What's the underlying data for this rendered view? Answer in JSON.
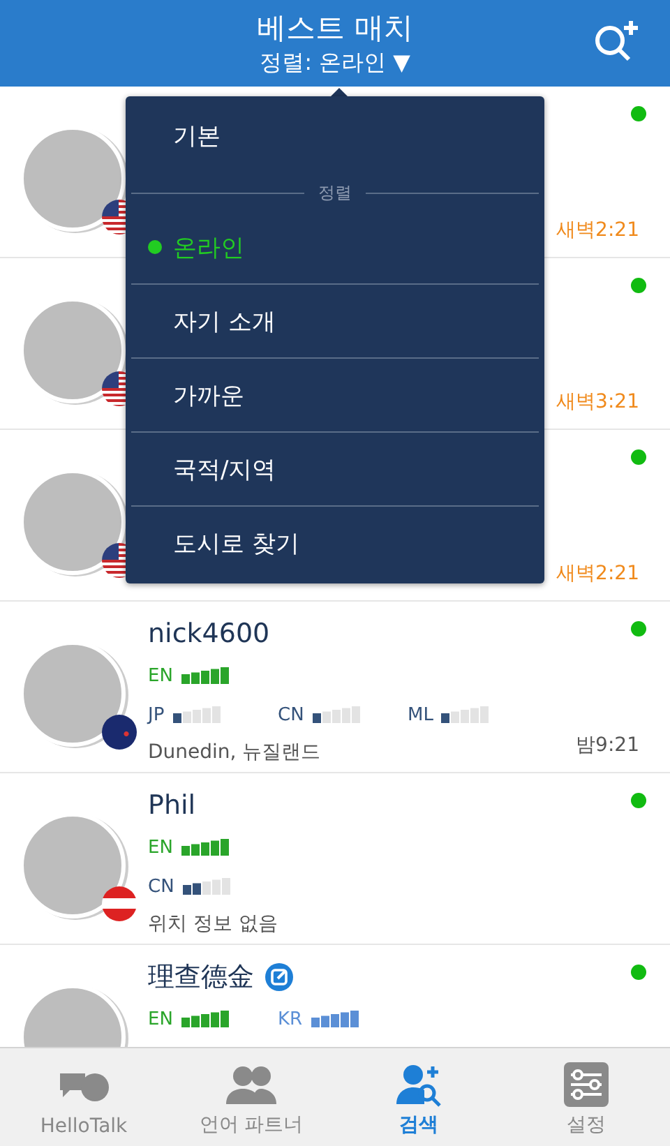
{
  "header": {
    "title": "베스트 매치",
    "sort_label": "정렬: 온라인 ▼"
  },
  "rows": [
    {
      "online": true,
      "time": {
        "text": "새벽2:21",
        "color": "#f08a1c"
      }
    },
    {
      "online": true,
      "time": {
        "text": "새벽3:21",
        "color": "#f08a1c"
      }
    },
    {
      "online": true,
      "time": {
        "text": "새벽2:21",
        "color": "#f08a1c"
      }
    },
    {
      "name": "nick4600",
      "online": true,
      "language_lines": [
        [
          {
            "code": "EN",
            "stars": 5,
            "color": "#2aa52a"
          }
        ],
        [
          {
            "code": "JP",
            "stars": 1,
            "color": "#34527a"
          },
          {
            "code": "CN",
            "stars": 1,
            "color": "#34527a"
          },
          {
            "code": "ML",
            "stars": 1,
            "color": "#34527a"
          }
        ]
      ],
      "location": "Dunedin, 뉴질랜드",
      "time": {
        "text": "밤9:21",
        "color": "#555555"
      }
    },
    {
      "name": "Phil",
      "online": true,
      "language_lines": [
        [
          {
            "code": "EN",
            "stars": 5,
            "color": "#2aa52a"
          }
        ],
        [
          {
            "code": "CN",
            "stars": 2,
            "color": "#34527a"
          }
        ]
      ],
      "location": "위치 정보 없음"
    },
    {
      "name": "理查德金",
      "verified": true,
      "online": true,
      "language_lines": [
        [
          {
            "code": "EN",
            "stars": 5,
            "color": "#2aa52a"
          },
          {
            "code": "KR",
            "stars": 5,
            "color": "#5b8fd6"
          }
        ]
      ]
    }
  ],
  "sort_menu": {
    "items": [
      {
        "label": "기본",
        "kind": "item",
        "selected": false
      },
      {
        "label": "정렬",
        "kind": "header"
      },
      {
        "label": "온라인",
        "kind": "item",
        "selected": true
      },
      {
        "label": "자기 소개",
        "kind": "item",
        "selected": false
      },
      {
        "label": "가까운",
        "kind": "item",
        "selected": false
      },
      {
        "label": "국적/지역",
        "kind": "item",
        "selected": false
      },
      {
        "label": "도시로 찾기",
        "kind": "item",
        "selected": false
      }
    ]
  },
  "tabs": [
    {
      "label": "HelloTalk",
      "selected": false
    },
    {
      "label": "언어 파트너",
      "selected": false
    },
    {
      "label": "검색",
      "selected": true
    },
    {
      "label": "설정",
      "selected": false
    }
  ]
}
